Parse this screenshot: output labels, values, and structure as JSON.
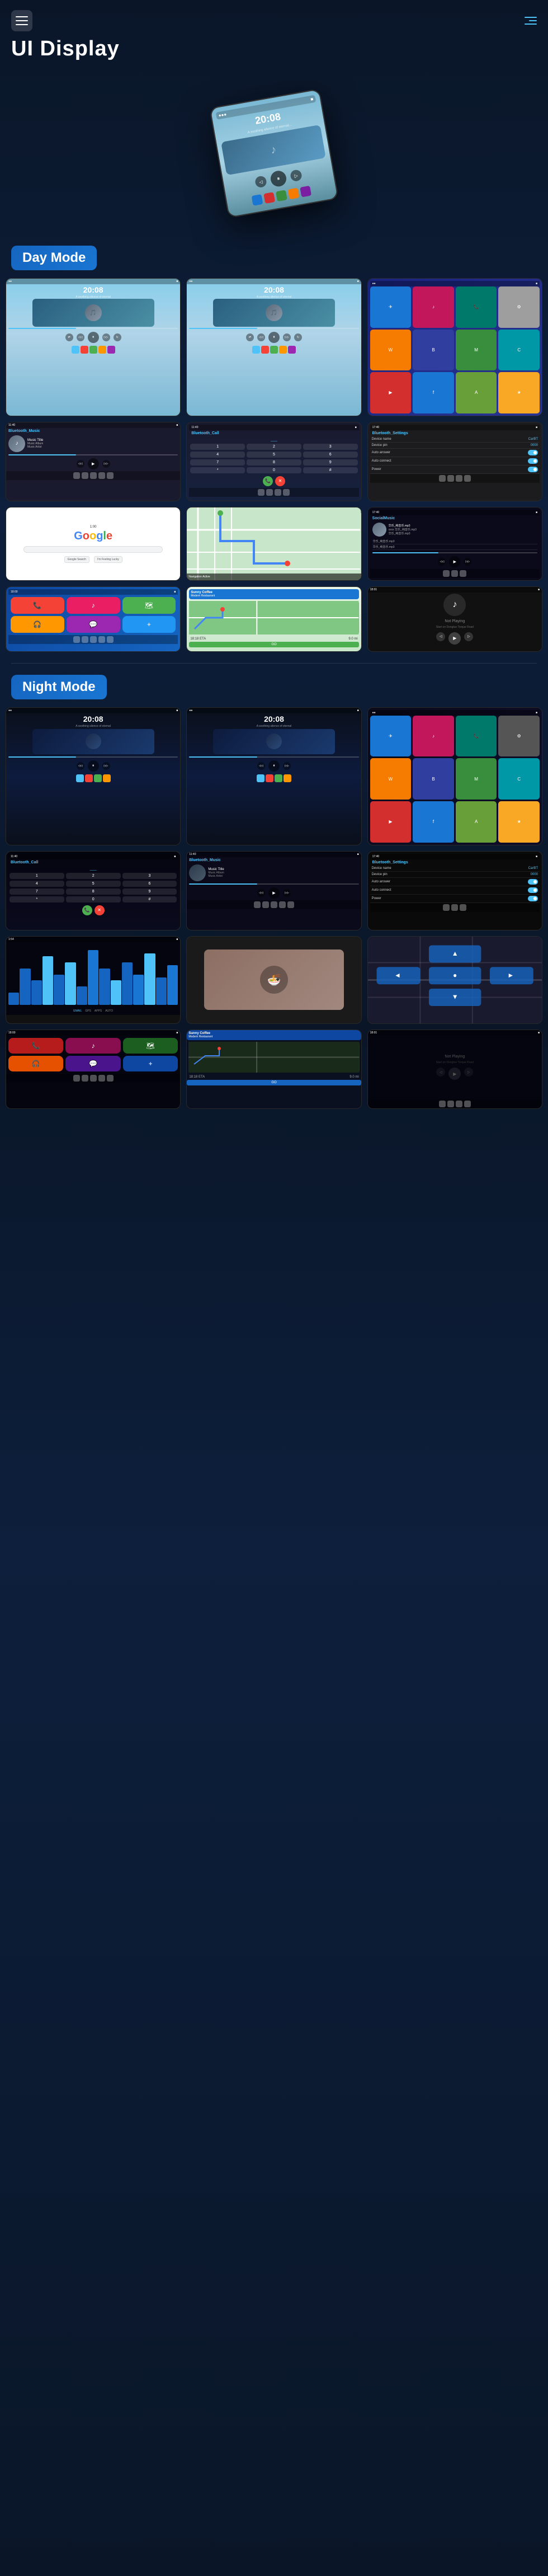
{
  "header": {
    "menu_label": "Menu",
    "nav_label": "Navigation"
  },
  "page": {
    "title": "UI Display"
  },
  "hero": {
    "time": "20:08",
    "subtitle": "A soothing silence of eternal..."
  },
  "sections": {
    "day_mode": "Day Mode",
    "night_mode": "Night Mode"
  },
  "day_screenshots": [
    {
      "id": "day-music-1",
      "type": "music",
      "time": "20:08",
      "subtitle": "A soothing silence of eternal"
    },
    {
      "id": "day-music-2",
      "type": "music",
      "time": "20:08",
      "subtitle": "A soothing silence of eternal"
    },
    {
      "id": "day-apps",
      "type": "apps"
    },
    {
      "id": "day-bluetooth-music",
      "type": "bluetooth-music",
      "title": "Bluetooth_Music",
      "track": "Music Title",
      "album": "Music Album",
      "artist": "Music Artist"
    },
    {
      "id": "day-bluetooth-call",
      "type": "bluetooth-call",
      "title": "Bluetooth_Call"
    },
    {
      "id": "day-bluetooth-settings",
      "type": "bluetooth-settings",
      "title": "Bluetooth_Settings",
      "device_name_label": "Device name",
      "device_name_val": "CarBT",
      "device_pin_label": "Device pin",
      "device_pin_val": "0000",
      "auto_answer_label": "Auto answer",
      "auto_connect_label": "Auto connect",
      "power_label": "Power"
    },
    {
      "id": "day-google",
      "type": "google"
    },
    {
      "id": "day-map",
      "type": "map"
    },
    {
      "id": "day-social-music",
      "type": "social-music",
      "title": "SocialMusic",
      "tracks": [
        "华乐_纯音乐.mp3",
        "xxxx 华乐_纯音乐.mp3",
        "华乐_纯音乐.mp3",
        "华乐_纯音乐.mp3",
        "华乐_纯音乐.mp3"
      ]
    },
    {
      "id": "day-carplay-apps",
      "type": "carplay-apps"
    },
    {
      "id": "day-coffee-nav",
      "type": "coffee-nav",
      "restaurant": "Sunny Coffee Modern Restaurant",
      "eta": "18:18 ETA",
      "distance": "9.0 mi",
      "go_label": "GO"
    },
    {
      "id": "day-notplaying",
      "type": "notplaying",
      "message": "Not Playing",
      "start_label": "Start on Donglue Torque Road"
    }
  ],
  "night_screenshots": [
    {
      "id": "night-music-1",
      "type": "music-night",
      "time": "20:08"
    },
    {
      "id": "night-music-2",
      "type": "music-night",
      "time": "20:08"
    },
    {
      "id": "night-apps",
      "type": "apps-night"
    },
    {
      "id": "night-bluetooth-call",
      "type": "bluetooth-call-night",
      "title": "Bluetooth_Call"
    },
    {
      "id": "night-bluetooth-music",
      "type": "bluetooth-music-night",
      "title": "Bluetooth_Music",
      "track": "Music Title",
      "album": "Music Album",
      "artist": "Music Artist"
    },
    {
      "id": "night-bluetooth-settings",
      "type": "bluetooth-settings-night",
      "title": "Bluetooth_Settings",
      "device_name_label": "Device name",
      "device_name_val": "CarBT",
      "device_pin_label": "Device pin",
      "device_pin_val": "0000",
      "auto_answer_label": "Auto answer",
      "auto_connect_label": "Auto connect",
      "power_label": "Power"
    },
    {
      "id": "night-waves",
      "type": "waves-night"
    },
    {
      "id": "night-food",
      "type": "food-night"
    },
    {
      "id": "night-roads",
      "type": "roads-night"
    },
    {
      "id": "night-carplay-apps",
      "type": "carplay-apps-night"
    },
    {
      "id": "night-coffee-nav",
      "type": "coffee-nav-night",
      "restaurant": "Sunny Coffee Modern Restaurant",
      "eta": "18:18 ETA",
      "distance": "9.0 mi",
      "go_label": "GO"
    },
    {
      "id": "night-notplaying",
      "type": "notplaying-night",
      "message": "Not Playing",
      "start_label": "Start on Donglue Torque Road"
    }
  ],
  "app_colors": {
    "phone": "#1976d2",
    "music": "#e91e63",
    "maps": "#34a853",
    "settings": "#9e9e9e",
    "messages": "#4caf50",
    "photos": "#ff9800",
    "safari": "#0288d1",
    "camera": "#607d8b"
  }
}
